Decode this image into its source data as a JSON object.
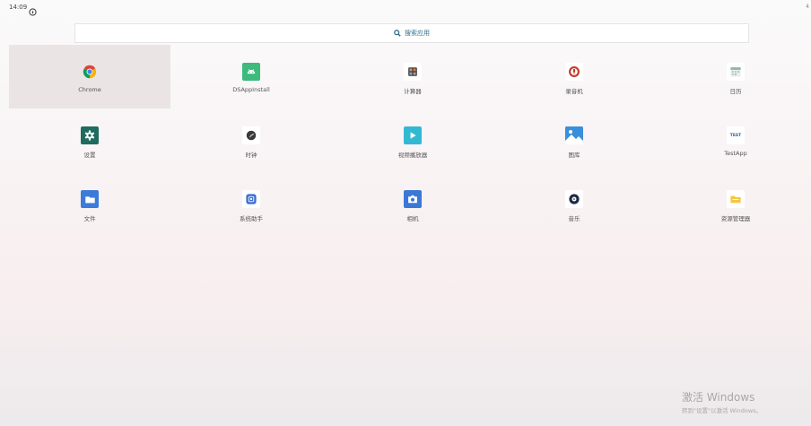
{
  "status_bar": {
    "time": "14:09",
    "right_text": "4"
  },
  "search": {
    "placeholder": "搜索应用"
  },
  "apps": [
    {
      "label": "Chrome",
      "icon": "chrome-icon"
    },
    {
      "label": "DSAppInstall",
      "icon": "android-icon"
    },
    {
      "label": "计算器",
      "icon": "calculator-icon"
    },
    {
      "label": "录音机",
      "icon": "recorder-icon"
    },
    {
      "label": "日历",
      "icon": "calendar-icon"
    },
    {
      "label": "设置",
      "icon": "settings-icon"
    },
    {
      "label": "时钟",
      "icon": "clock-icon"
    },
    {
      "label": "视频播放器",
      "icon": "video-player-icon"
    },
    {
      "label": "图库",
      "icon": "gallery-icon"
    },
    {
      "label": "TestApp",
      "icon": "testapp-icon",
      "icon_text": "TEST"
    },
    {
      "label": "文件",
      "icon": "folder-icon"
    },
    {
      "label": "系统助手",
      "icon": "system-assistant-icon"
    },
    {
      "label": "相机",
      "icon": "camera-icon"
    },
    {
      "label": "音乐",
      "icon": "music-icon"
    },
    {
      "label": "资源管理器",
      "icon": "file-manager-icon"
    }
  ],
  "selected_app": "Chrome",
  "watermark": {
    "title": "激活 Windows",
    "subtitle": "转到\"设置\"以激活 Windows。"
  },
  "colors": {
    "accent": "#2f6f8f",
    "selected_tile": "#ebe4e5",
    "settings_green": "#1f6b5f",
    "android_green": "#3dba7c",
    "folder_blue": "#3d7bd9",
    "camera_blue": "#3b78d6",
    "video_cyan": "#33b8d4",
    "file_manager_yellow": "#f5c542"
  }
}
